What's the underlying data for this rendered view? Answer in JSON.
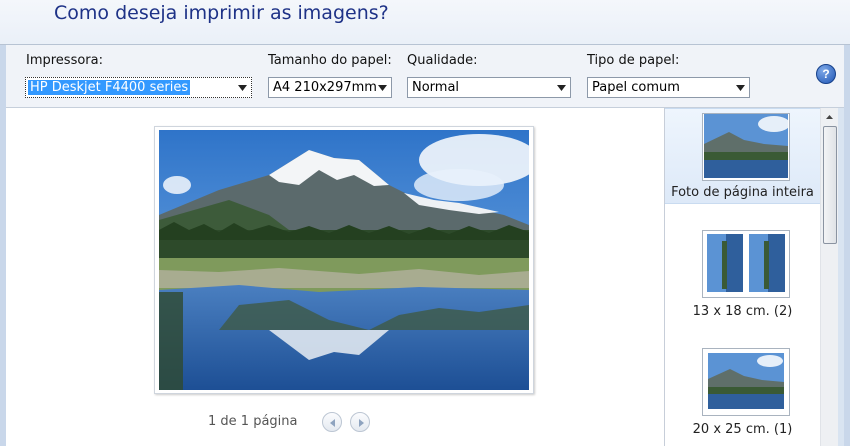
{
  "window": {
    "title": "Como deseja imprimir as imagens?"
  },
  "toolbar": {
    "printer": {
      "label": "Impressora:",
      "value": "HP Deskjet F4400 series"
    },
    "paper_size": {
      "label": "Tamanho do papel:",
      "value": "A4 210x297mm"
    },
    "quality": {
      "label": "Qualidade:",
      "value": "Normal"
    },
    "paper_type": {
      "label": "Tipo de papel:",
      "value": "Papel comum"
    },
    "help": "?"
  },
  "preview": {
    "page_info": "1 de 1 página",
    "prev_icon": "arrow-left-icon",
    "next_icon": "arrow-right-icon"
  },
  "layouts": [
    {
      "label": "Foto de página inteira",
      "selected": true
    },
    {
      "label": "13 x 18 cm. (2)",
      "selected": false
    },
    {
      "label": "20 x 25 cm. (1)",
      "selected": false
    }
  ],
  "colors": {
    "title": "#1e3287",
    "selection": "#3399ff",
    "header_bg": "#eaf0f8"
  }
}
